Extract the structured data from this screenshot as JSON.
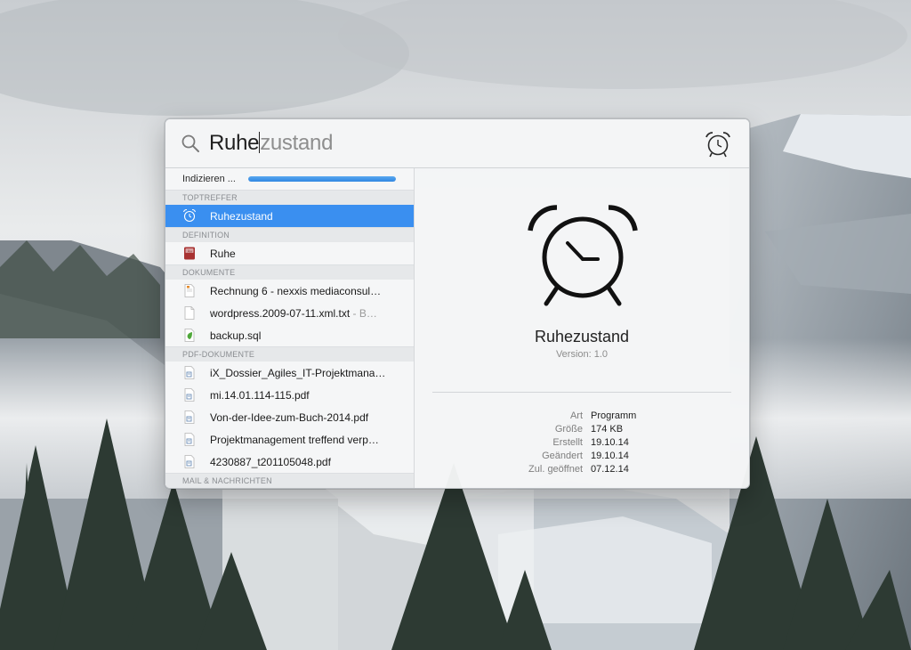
{
  "search": {
    "typed": "Ruhe",
    "completion": "zustand"
  },
  "indexing": {
    "label": "Indizieren ...",
    "progress": 1.0
  },
  "sections": [
    {
      "header": "TOPTREFFER",
      "items": [
        {
          "label": "Ruhezustand",
          "icon": "alarm-clock-icon",
          "selected": true
        }
      ]
    },
    {
      "header": "DEFINITION",
      "items": [
        {
          "label": "Ruhe",
          "icon": "dictionary-icon"
        }
      ]
    },
    {
      "header": "DOKUMENTE",
      "items": [
        {
          "label": "Rechnung 6 - nexxis mediaconsul…",
          "icon": "document-icon"
        },
        {
          "label": "wordpress.2009-07-11.xml.txt",
          "sub": " - B…",
          "icon": "text-file-icon"
        },
        {
          "label": "backup.sql",
          "icon": "sql-file-icon"
        }
      ]
    },
    {
      "header": "PDF-DOKUMENTE",
      "items": [
        {
          "label": "iX_Dossier_Agiles_IT-Projektmana…",
          "icon": "pdf-icon"
        },
        {
          "label": "mi.14.01.114-115.pdf",
          "icon": "pdf-icon"
        },
        {
          "label": "Von-der-Idee-zum-Buch-2014.pdf",
          "icon": "pdf-icon"
        },
        {
          "label": "Projektmanagement treffend verp…",
          "icon": "pdf-icon"
        },
        {
          "label": "4230887_t201105048.pdf",
          "icon": "pdf-icon"
        }
      ]
    },
    {
      "header": "MAIL & NACHRICHTEN",
      "items": []
    }
  ],
  "preview": {
    "title": "Ruhezustand",
    "version": "Version: 1.0",
    "metadata": [
      {
        "key": "Art",
        "value": "Programm"
      },
      {
        "key": "Größe",
        "value": "174 KB"
      },
      {
        "key": "Erstellt",
        "value": "19.10.14"
      },
      {
        "key": "Geändert",
        "value": "19.10.14"
      },
      {
        "key": "Zul. geöffnet",
        "value": "07.12.14"
      }
    ]
  },
  "colors": {
    "selection": "#3a8ff0",
    "progress": "#2f86e2"
  }
}
